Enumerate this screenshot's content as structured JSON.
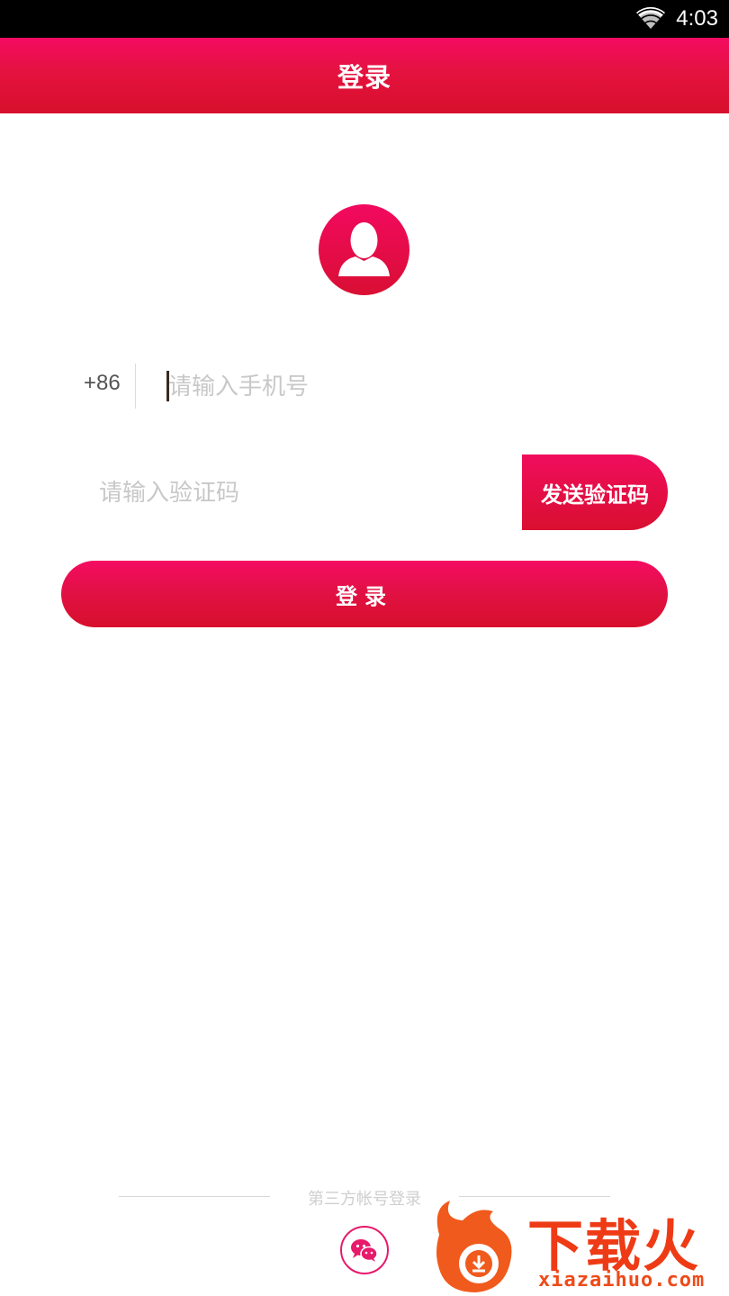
{
  "status_bar": {
    "time": "4:03",
    "wifi_icon": "wifi-icon"
  },
  "header": {
    "title": "登录"
  },
  "avatar": {
    "icon": "user-avatar-icon"
  },
  "phone": {
    "country_code": "+86",
    "placeholder": "请输入手机号",
    "value": ""
  },
  "verification": {
    "placeholder": "请输入验证码",
    "value": "",
    "send_button_label": "发送验证码"
  },
  "login_button_label": "登录",
  "third_party": {
    "label": "第三方帐号登录",
    "wechat_icon": "wechat-icon"
  },
  "watermark": {
    "brand": "下载火",
    "url": "xiazaihuo.com"
  },
  "colors": {
    "accent": "#e4123f",
    "accent_top": "#f50b62",
    "placeholder": "#c8c8c8",
    "watermark": "#ee3b16"
  }
}
